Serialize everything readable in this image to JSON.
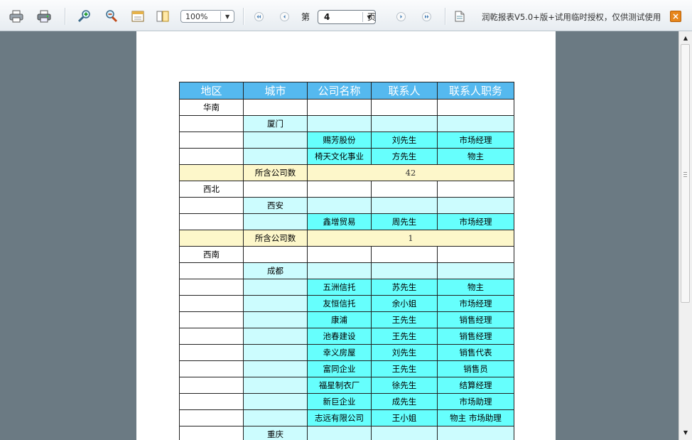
{
  "toolbar": {
    "zoom_value": "100%",
    "page_prefix": "第",
    "current_page": "4",
    "page_suffix": "页",
    "license_text": "润乾报表V5.0+版+试用临时授权，仅供测试使用",
    "close_label": "×",
    "icons": [
      "print-icon",
      "print-preview-icon",
      "zoom-in-icon",
      "zoom-out-icon",
      "page-setup-icon",
      "fit-page-icon",
      "first-page-icon",
      "prev-page-icon",
      "next-page-icon",
      "last-page-icon",
      "export-icon"
    ]
  },
  "report": {
    "headers": [
      "地区",
      "城市",
      "公司名称",
      "联系人",
      "联系人职务"
    ],
    "colors": {
      "header": "#55b9ef",
      "region": "#ffffff",
      "city": "#ccfcfe",
      "detail": "#66fffd",
      "subtotal": "#fdf7ca"
    },
    "rows": [
      {
        "type": "region",
        "cells": [
          "华南",
          "",
          "",
          "",
          ""
        ]
      },
      {
        "type": "city",
        "cells": [
          "",
          "厦门",
          "",
          "",
          ""
        ]
      },
      {
        "type": "detail",
        "cells": [
          "",
          "",
          "赐芳股份",
          "刘先生",
          "市场经理"
        ]
      },
      {
        "type": "detail",
        "cells": [
          "",
          "",
          "椅天文化事业",
          "方先生",
          "物主"
        ]
      },
      {
        "type": "subtotal",
        "label": "所含公司数",
        "value": "42"
      },
      {
        "type": "region",
        "cells": [
          "西北",
          "",
          "",
          "",
          ""
        ]
      },
      {
        "type": "city",
        "cells": [
          "",
          "西安",
          "",
          "",
          ""
        ]
      },
      {
        "type": "detail",
        "cells": [
          "",
          "",
          "鑫增贸易",
          "周先生",
          "市场经理"
        ]
      },
      {
        "type": "subtotal",
        "label": "所含公司数",
        "value": "1"
      },
      {
        "type": "region",
        "cells": [
          "西南",
          "",
          "",
          "",
          ""
        ]
      },
      {
        "type": "city",
        "cells": [
          "",
          "成都",
          "",
          "",
          ""
        ]
      },
      {
        "type": "detail",
        "cells": [
          "",
          "",
          "五洲信托",
          "苏先生",
          "物主"
        ]
      },
      {
        "type": "detail",
        "cells": [
          "",
          "",
          "友恒信托",
          "余小姐",
          "市场经理"
        ]
      },
      {
        "type": "detail",
        "cells": [
          "",
          "",
          "康浦",
          "王先生",
          "销售经理"
        ]
      },
      {
        "type": "detail",
        "cells": [
          "",
          "",
          "池春建设",
          "王先生",
          "销售经理"
        ]
      },
      {
        "type": "detail",
        "cells": [
          "",
          "",
          "幸义房屋",
          "刘先生",
          "销售代表"
        ]
      },
      {
        "type": "detail",
        "cells": [
          "",
          "",
          "富同企业",
          "王先生",
          "销售员"
        ]
      },
      {
        "type": "detail",
        "cells": [
          "",
          "",
          "福星制衣厂",
          "徐先生",
          "结算经理"
        ]
      },
      {
        "type": "detail",
        "cells": [
          "",
          "",
          "新巨企业",
          "成先生",
          "市场助理"
        ]
      },
      {
        "type": "detail",
        "cells": [
          "",
          "",
          "志远有限公司",
          "王小姐",
          "物主 市场助理"
        ]
      },
      {
        "type": "city",
        "cells": [
          "",
          "重庆",
          "",
          "",
          ""
        ]
      }
    ]
  }
}
